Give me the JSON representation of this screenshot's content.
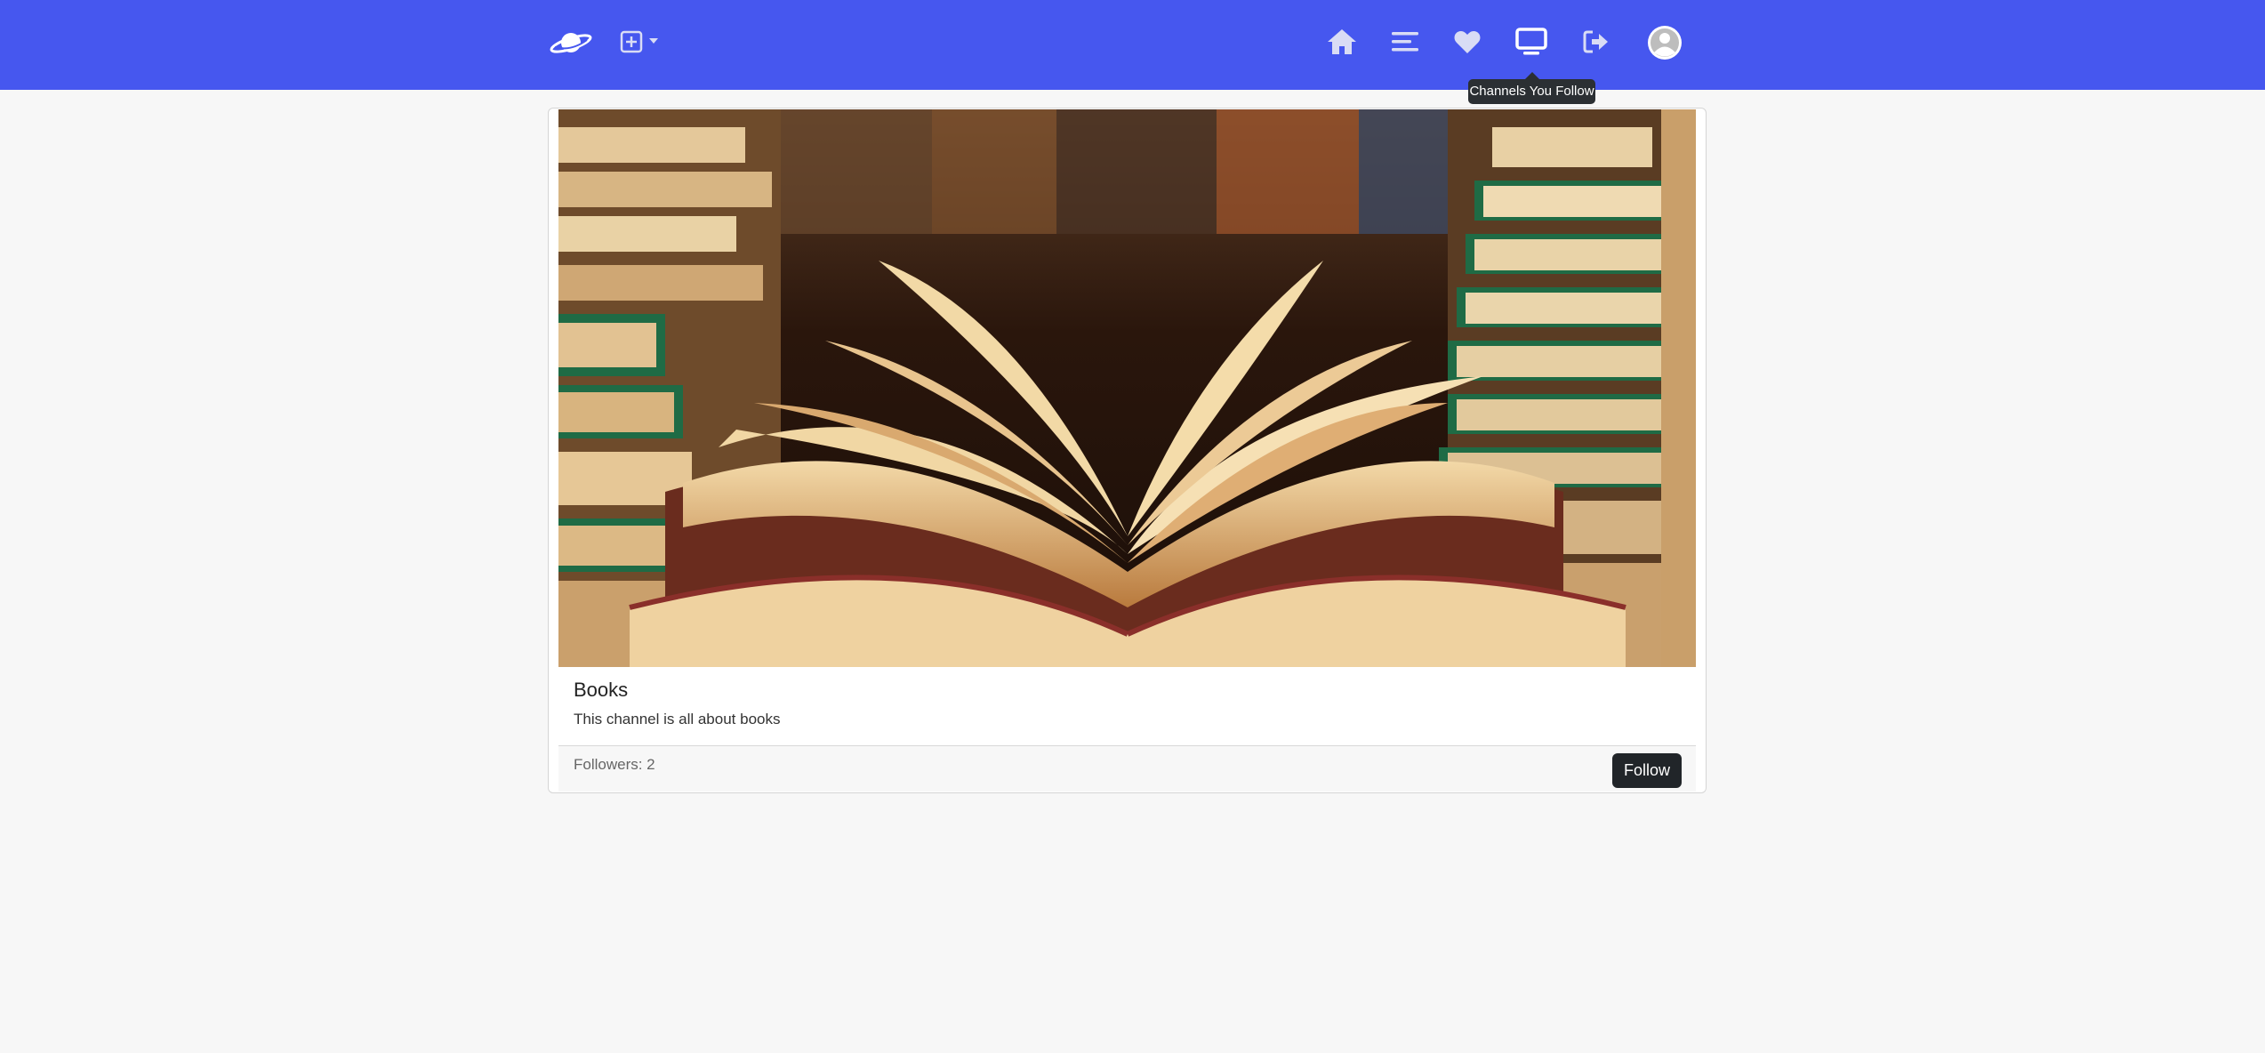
{
  "theme": {
    "nav_bg": "#4657ef"
  },
  "nav": {
    "icons": [
      "planet-logo-icon",
      "add-square-icon",
      "caret-down-icon",
      "home-icon",
      "menu-lines-icon",
      "heart-icon",
      "monitor-icon",
      "logout-icon",
      "user-avatar-icon"
    ],
    "tooltip": "Channels You Follow"
  },
  "channel": {
    "title": "Books",
    "description": "This channel is all about books",
    "followers": "Followers: 2",
    "follow_label": "Follow"
  }
}
